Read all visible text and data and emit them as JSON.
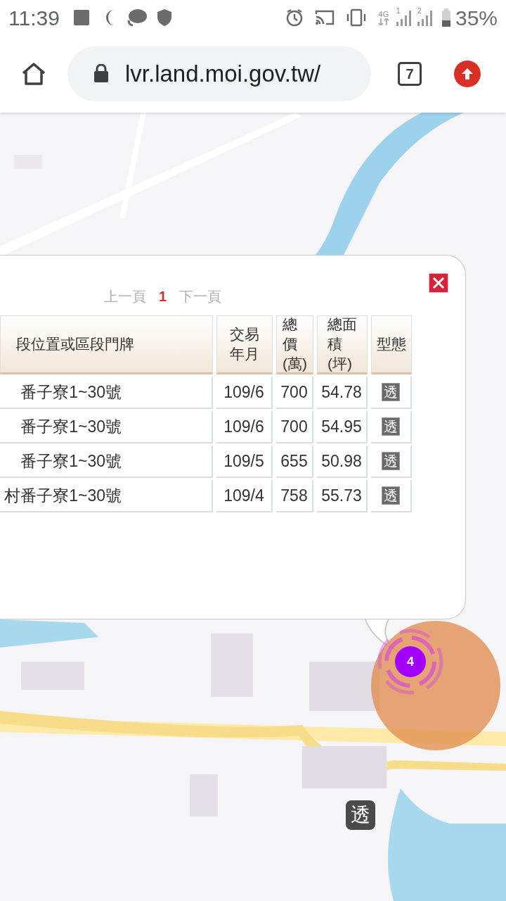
{
  "status_bar": {
    "time": "11:39",
    "network": "4G",
    "sims": [
      "1",
      "2"
    ],
    "battery": "35%"
  },
  "browser": {
    "url": "lvr.land.moi.gov.tw/",
    "tab_count": "7"
  },
  "popup": {
    "pager": {
      "prev": "上一頁",
      "page": "1",
      "next": "下一頁"
    },
    "columns": [
      [
        "段位置或區段門牌"
      ],
      [
        "交易",
        "年月"
      ],
      [
        "總",
        "價",
        "(萬)"
      ],
      [
        "總面",
        "積",
        "(坪)"
      ],
      [
        "型態"
      ]
    ],
    "rows": [
      {
        "address": "番子寮1~30號",
        "date": "109/6",
        "price": "700",
        "area": "54.78",
        "type": "透"
      },
      {
        "address": "番子寮1~30號",
        "date": "109/6",
        "price": "700",
        "area": "54.95",
        "type": "透"
      },
      {
        "address": "番子寮1~30號",
        "date": "109/5",
        "price": "655",
        "area": "50.98",
        "type": "透"
      },
      {
        "address": "村番子寮1~30號",
        "date": "109/4",
        "price": "758",
        "area": "55.73",
        "type": "透"
      }
    ]
  },
  "map": {
    "cluster_count": "4",
    "marker": "透"
  }
}
